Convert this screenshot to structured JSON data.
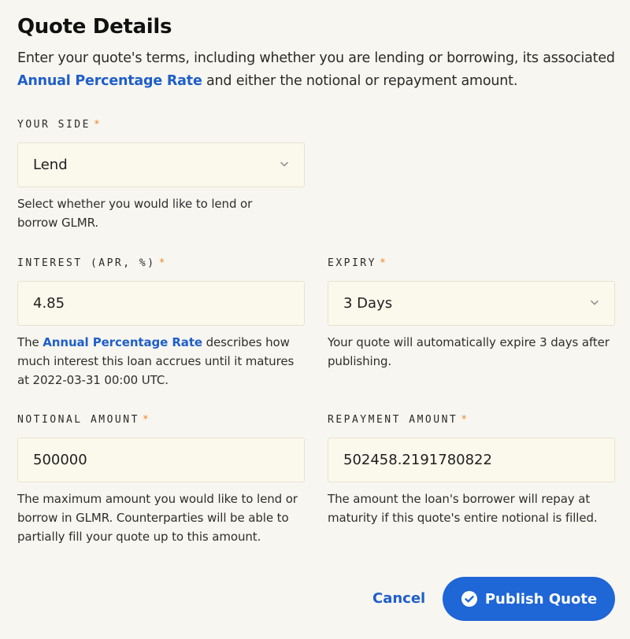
{
  "header": {
    "title": "Quote Details",
    "intro_before": "Enter your quote's terms, including whether you are lending or borrowing, its associated ",
    "intro_link": "Annual Percentage Rate",
    "intro_after": " and either the notional or repayment amount."
  },
  "side": {
    "label": "YOUR SIDE",
    "required": "*",
    "value": "Lend",
    "help": "Select whether you would like to lend or borrow GLMR."
  },
  "interest": {
    "label": "INTEREST (APR, %)",
    "required": "*",
    "value": "4.85",
    "help_before": "The ",
    "help_link": "Annual Percentage Rate",
    "help_after": " describes how much interest this loan accrues until it matures at 2022-03-31 00:00 UTC."
  },
  "expiry": {
    "label": "EXPIRY",
    "required": "*",
    "value": "3 Days",
    "help": "Your quote will automatically expire 3 days after publishing."
  },
  "notional": {
    "label": "NOTIONAL AMOUNT",
    "required": "*",
    "value": "500000",
    "help": "The maximum amount you would like to lend or borrow in GLMR. Counterparties will be able to partially fill your quote up to this amount."
  },
  "repayment": {
    "label": "REPAYMENT AMOUNT",
    "required": "*",
    "value": "502458.2191780822",
    "help": "The amount the loan's borrower will repay at maturity if this quote's entire notional is filled."
  },
  "actions": {
    "cancel": "Cancel",
    "publish": "Publish Quote"
  },
  "icons": {
    "chevron": "chevron-down-icon",
    "check": "check-circle-icon"
  },
  "colors": {
    "accent": "#1f66d6",
    "link": "#1f5fc9",
    "required": "#e68a2e",
    "background": "#f8f6f0",
    "field": "#fbf8ec"
  }
}
